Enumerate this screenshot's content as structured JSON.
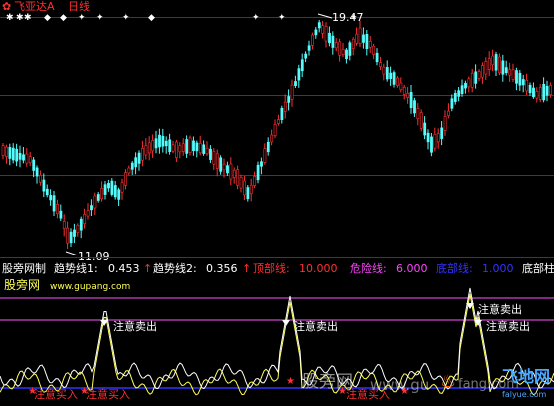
{
  "header": {
    "title_icon": "gear-icon",
    "stock_name": "飞亚达A",
    "period": "日线",
    "title_color": "#ff3030"
  },
  "price_panel": {
    "high_label": "19.47",
    "low_label": "11.09",
    "marker_glyphs": [
      "✱✱",
      "◆",
      "✦",
      "✦",
      "◆",
      "✦",
      "✦",
      "◆"
    ]
  },
  "indicator_bar": {
    "source": "股旁网制",
    "items": [
      {
        "label": "趋势线1:",
        "value": "0.453",
        "arrow": "↑",
        "color": "#ffffff"
      },
      {
        "label": "趋势线2:",
        "value": "0.356",
        "arrow": "↑",
        "color": "#ffffff"
      },
      {
        "label": "顶部线:",
        "value": "10.000",
        "color": "#ff3030"
      },
      {
        "label": "危险线:",
        "value": "6.000",
        "color": "#ff00ff"
      },
      {
        "label": "底部线:",
        "value": "1.000",
        "color": "#3030ff"
      }
    ],
    "tail": "底部柱"
  },
  "lower_panel": {
    "site_name": "股旁网",
    "site_url": "www.gupang.com",
    "sell_label": "注意卖出",
    "buy_label": "注意买入"
  },
  "watermark": {
    "text1": "股旁网",
    "text2": "www.gu",
    "text3": "fang.com",
    "logo_text": "飞地网",
    "logo_sub": "falyue.com"
  },
  "colors": {
    "up": "#ff3030",
    "down": "#54fcfc",
    "line_white": "#ffffff",
    "line_yellow": "#ffff55",
    "top_line": "#ff55ff",
    "danger_line": "#ff55ff",
    "bottom_line": "#3333ff"
  }
}
